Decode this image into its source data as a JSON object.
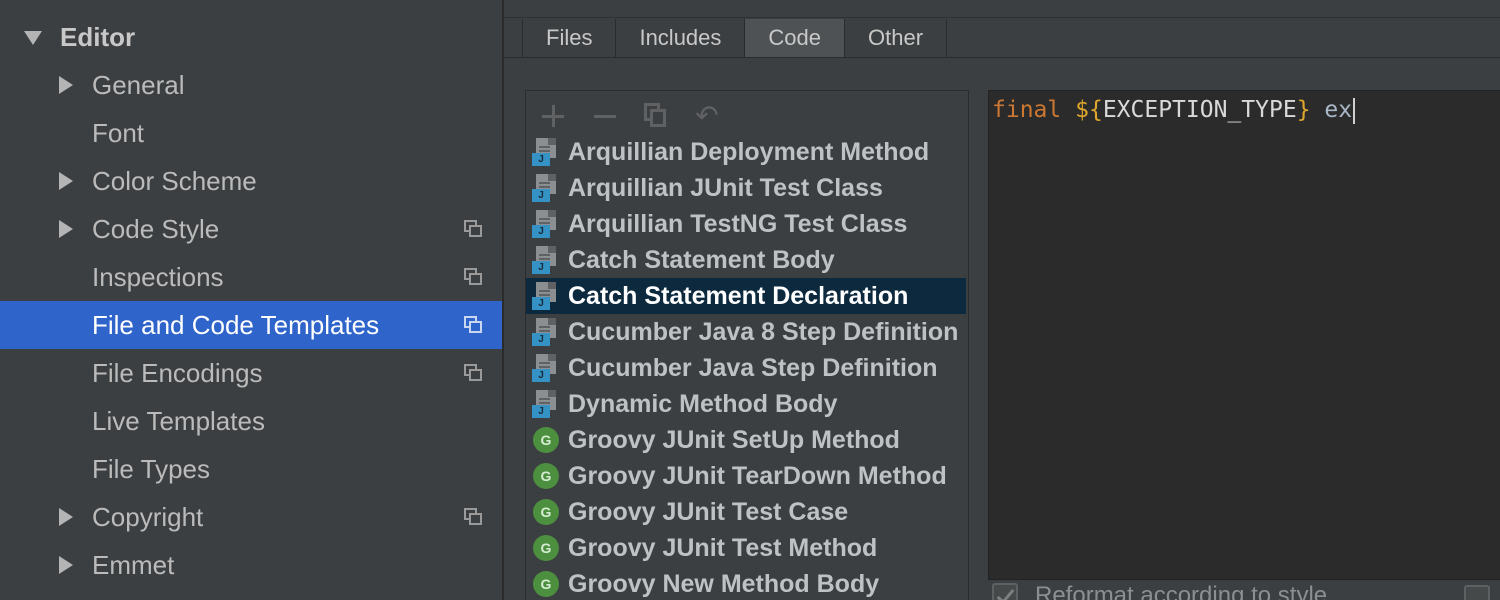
{
  "sidebar": {
    "section": {
      "label": "Editor",
      "state": "expanded"
    },
    "items": [
      {
        "label": "General",
        "has_arrow": true,
        "has_copy": false,
        "selected": false
      },
      {
        "label": "Font",
        "has_arrow": false,
        "has_copy": false,
        "selected": false
      },
      {
        "label": "Color Scheme",
        "has_arrow": true,
        "has_copy": false,
        "selected": false
      },
      {
        "label": "Code Style",
        "has_arrow": true,
        "has_copy": true,
        "selected": false
      },
      {
        "label": "Inspections",
        "has_arrow": false,
        "has_copy": true,
        "selected": false
      },
      {
        "label": "File and Code Templates",
        "has_arrow": false,
        "has_copy": true,
        "selected": true
      },
      {
        "label": "File Encodings",
        "has_arrow": false,
        "has_copy": true,
        "selected": false
      },
      {
        "label": "Live Templates",
        "has_arrow": false,
        "has_copy": false,
        "selected": false
      },
      {
        "label": "File Types",
        "has_arrow": false,
        "has_copy": false,
        "selected": false
      },
      {
        "label": "Copyright",
        "has_arrow": true,
        "has_copy": true,
        "selected": false
      },
      {
        "label": "Emmet",
        "has_arrow": true,
        "has_copy": false,
        "selected": false
      }
    ]
  },
  "tabs": [
    {
      "label": "Files",
      "active": false
    },
    {
      "label": "Includes",
      "active": false
    },
    {
      "label": "Code",
      "active": true
    },
    {
      "label": "Other",
      "active": false
    }
  ],
  "toolbar": {
    "add_icon": "plus-icon",
    "remove_icon": "minus-icon",
    "copy_icon": "copy-icon",
    "reset_icon": "revert-icon",
    "reset_glyph": "↶"
  },
  "templates": [
    {
      "label": "Arquillian Deployment Method",
      "kind": "java",
      "selected": false
    },
    {
      "label": "Arquillian JUnit Test Class",
      "kind": "java",
      "selected": false
    },
    {
      "label": "Arquillian TestNG Test Class",
      "kind": "java",
      "selected": false
    },
    {
      "label": "Catch Statement Body",
      "kind": "java",
      "selected": false
    },
    {
      "label": "Catch Statement Declaration",
      "kind": "java",
      "selected": true
    },
    {
      "label": "Cucumber Java 8 Step Definition",
      "kind": "java",
      "selected": false
    },
    {
      "label": "Cucumber Java Step Definition",
      "kind": "java",
      "selected": false
    },
    {
      "label": "Dynamic Method Body",
      "kind": "java",
      "selected": false
    },
    {
      "label": "Groovy JUnit SetUp Method",
      "kind": "groovy",
      "selected": false
    },
    {
      "label": "Groovy JUnit TearDown Method",
      "kind": "groovy",
      "selected": false
    },
    {
      "label": "Groovy JUnit Test Case",
      "kind": "groovy",
      "selected": false
    },
    {
      "label": "Groovy JUnit Test Method",
      "kind": "groovy",
      "selected": false
    },
    {
      "label": "Groovy New Method Body",
      "kind": "groovy",
      "selected": false
    }
  ],
  "icon_badges": {
    "java": "J",
    "groovy": "G"
  },
  "editor": {
    "keyword": "final",
    "var_open": "${",
    "var_name": "EXCEPTION_TYPE",
    "var_close": "}",
    "identifier": "ex"
  },
  "options": {
    "reformat_label": "Reformat according to style",
    "reformat_checked": true
  },
  "colors": {
    "selection_sidebar": "#2f65ca",
    "selection_list": "#0d293e",
    "keyword": "#cc7832",
    "variable": "#e0a72d"
  }
}
